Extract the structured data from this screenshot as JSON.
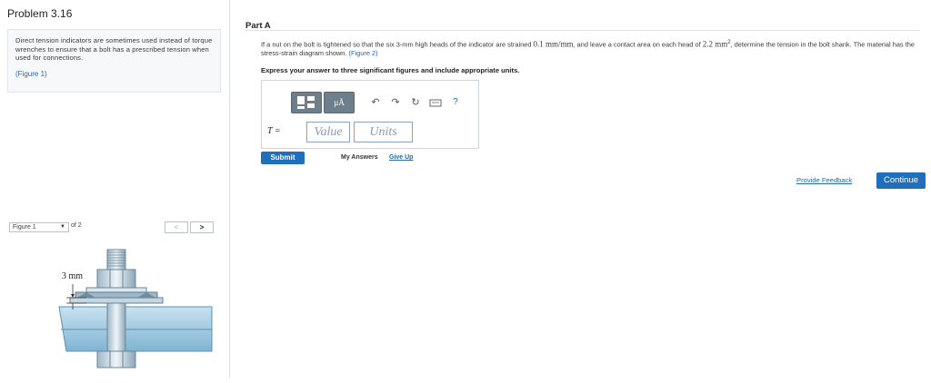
{
  "problem": {
    "title": "Problem 3.16",
    "text": "Direct tension indicators are sometimes used instead of torque wrenches to ensure that a bolt has a prescribed tension when used for connections.",
    "figure_link": "(Figure 1)"
  },
  "figure_nav": {
    "selected": "Figure 1",
    "of_label": "of 2",
    "prev": "<",
    "next": ">"
  },
  "figure": {
    "dimension_label": "3 mm"
  },
  "part": {
    "title": "Part A",
    "question_a": "If a nut on the bolt is tightened so that the six 3-mm high heads of the indicator are strained ",
    "strain_value": "0.1 mm/mm",
    "question_b": ", and leave a contact area on each head of ",
    "area_value": "2.2 mm",
    "question_c": ", determine the tension in the bolt shank. The material has the stress-strain diagram shown. ",
    "question_link": "(Figure 2)",
    "instruction": "Express your answer to three significant figures and include appropriate units."
  },
  "answer": {
    "variable": "T =",
    "value_placeholder": "Value",
    "units_placeholder": "Units",
    "toolbar": {
      "mu_label": "µÅ",
      "undo_icon": "↶",
      "redo_icon": "↷",
      "reset_icon": "↻",
      "help_icon": "?"
    }
  },
  "actions": {
    "submit": "Submit",
    "my_answers": "My Answers",
    "give_up": "Give Up",
    "feedback": "Provide Feedback",
    "continue": "Continue"
  },
  "colors": {
    "accent": "#1f6fbd",
    "link": "#2a66a8"
  }
}
